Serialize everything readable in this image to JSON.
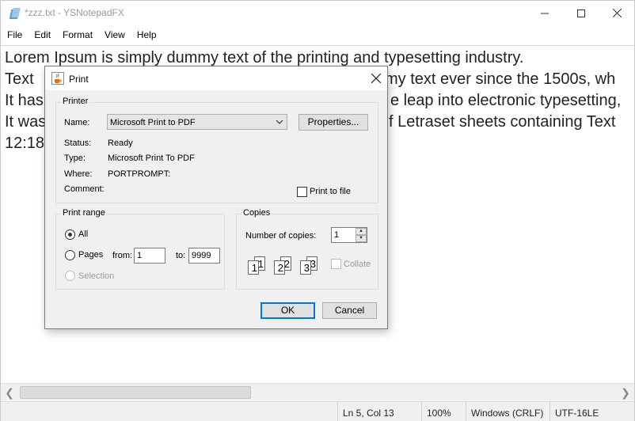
{
  "window": {
    "title": "*zzz.txt - YSNotepadFX"
  },
  "menu": [
    "File",
    "Edit",
    "Format",
    "View",
    "Help"
  ],
  "editor": {
    "lines": [
      "Lorem Ipsum is simply dummy text of the printing and typesetting industry.",
      "Text",
      "It has",
      "It was",
      "12:18"
    ],
    "lines_right": [
      "",
      "my text ever since the 1500s, wh",
      "e leap into electronic typesetting,",
      "f Letraset sheets containing Text",
      ""
    ]
  },
  "statusbar": {
    "position": "Ln 5, Col 13",
    "zoom": "100%",
    "line_ending": "Windows (CRLF)",
    "encoding": "UTF-16LE"
  },
  "dialog": {
    "title": "Print",
    "printer_group": "Printer",
    "name_label": "Name:",
    "printer_name": "Microsoft Print to PDF",
    "properties_button": "Properties...",
    "status_label": "Status:",
    "status_value": "Ready",
    "type_label": "Type:",
    "type_value": "Microsoft Print To PDF",
    "where_label": "Where:",
    "where_value": "PORTPROMPT:",
    "comment_label": "Comment:",
    "comment_value": "",
    "print_to_file": "Print to file",
    "range_group": "Print range",
    "range_all": "All",
    "range_pages": "Pages",
    "from_label": "from:",
    "from_value": "1",
    "to_label": "to:",
    "to_value": "9999",
    "range_selection": "Selection",
    "copies_group": "Copies",
    "copies_label": "Number of copies:",
    "copies_value": "1",
    "collate": "Collate",
    "page_numbers": [
      "1",
      "1",
      "2",
      "2",
      "3",
      "3"
    ],
    "ok_button": "OK",
    "cancel_button": "Cancel"
  },
  "colors": {
    "accent": "#0078d7",
    "dialog_bg": "#f0f0f0",
    "disabled_text": "#9a9a9a"
  }
}
